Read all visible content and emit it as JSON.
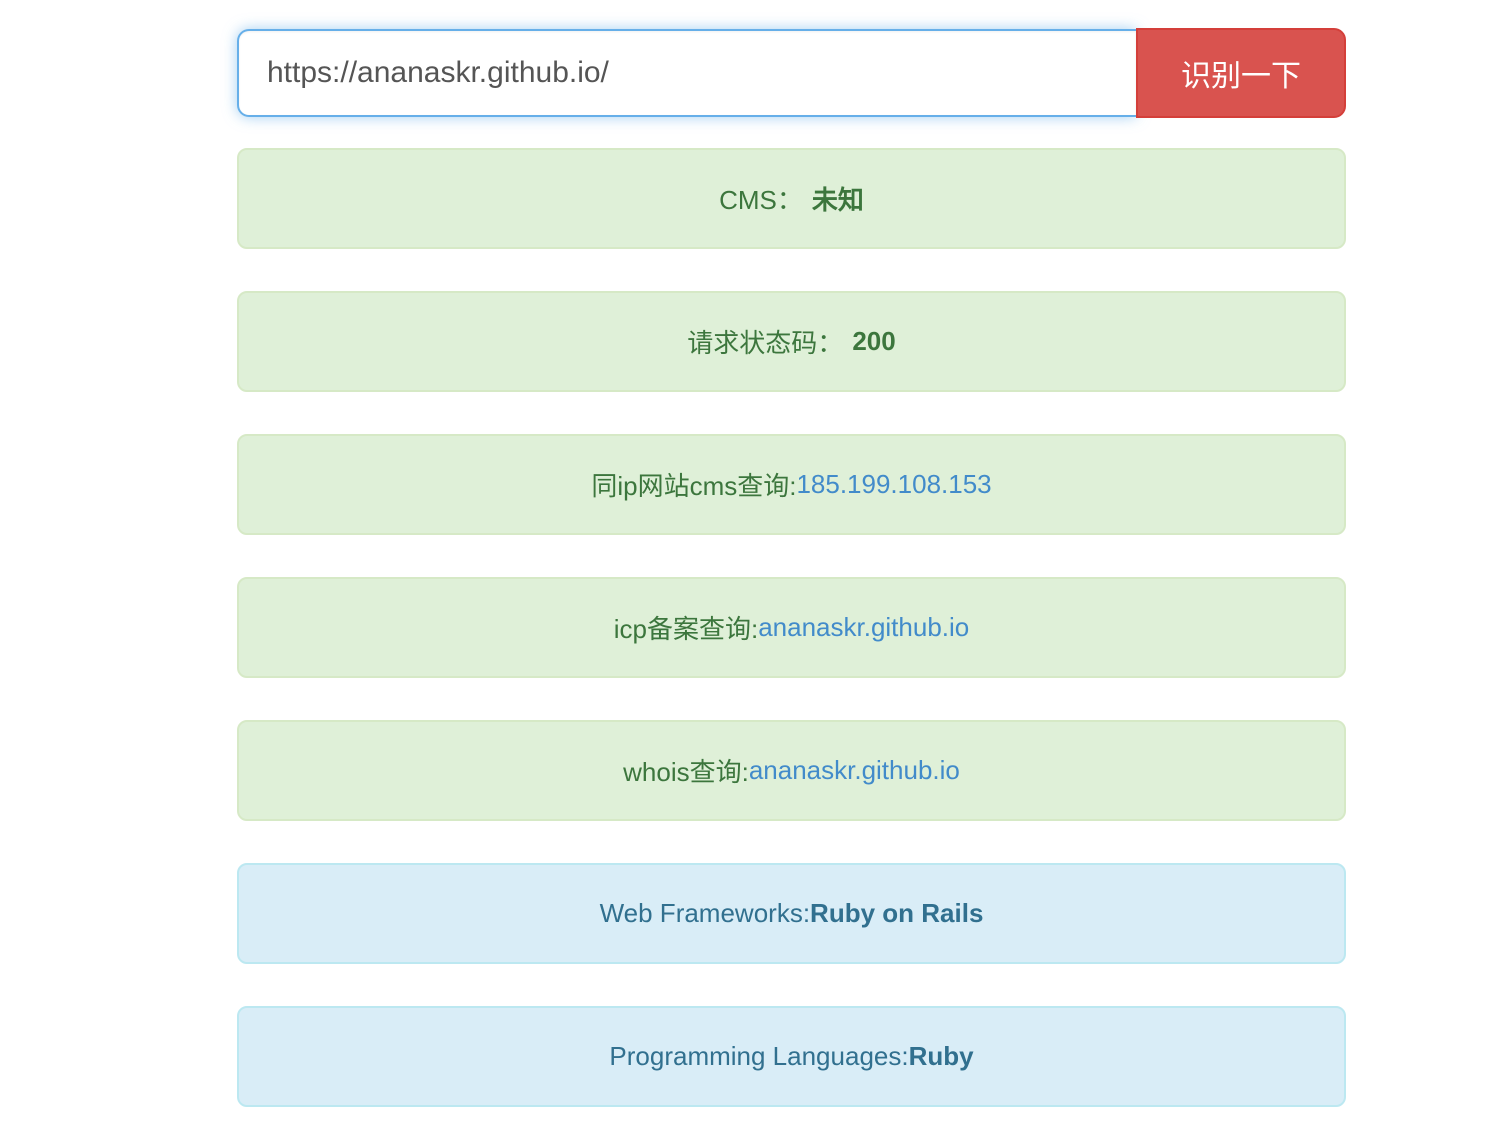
{
  "input_group": {
    "url_value": "https://ananaskr.github.io/",
    "button_label": "识别一下"
  },
  "results": [
    {
      "type": "success",
      "label": "CMS：",
      "value": "未知",
      "value_style": "bold"
    },
    {
      "type": "success",
      "label": "请求状态码：",
      "value": "200",
      "value_style": "bold"
    },
    {
      "type": "success",
      "label": "同ip网站cms查询:",
      "value": "185.199.108.153",
      "value_style": "link"
    },
    {
      "type": "success",
      "label": "icp备案查询:",
      "value": "ananaskr.github.io",
      "value_style": "link"
    },
    {
      "type": "success",
      "label": "whois查询:",
      "value": "ananaskr.github.io",
      "value_style": "link"
    },
    {
      "type": "info",
      "label": "Web Frameworks:",
      "value": "Ruby on Rails",
      "value_style": "bold"
    },
    {
      "type": "info",
      "label": "Programming Languages:",
      "value": "Ruby",
      "value_style": "bold"
    }
  ],
  "colors": {
    "button_bg": "#d9534f",
    "button_border": "#d43f3a",
    "input_focus_border": "#66afe9",
    "success_bg": "#dff0d8",
    "success_border": "#d6e9c6",
    "success_text": "#3c763d",
    "info_bg": "#d9edf7",
    "info_border": "#bce8f1",
    "info_text": "#31708f",
    "link": "#428bca"
  }
}
